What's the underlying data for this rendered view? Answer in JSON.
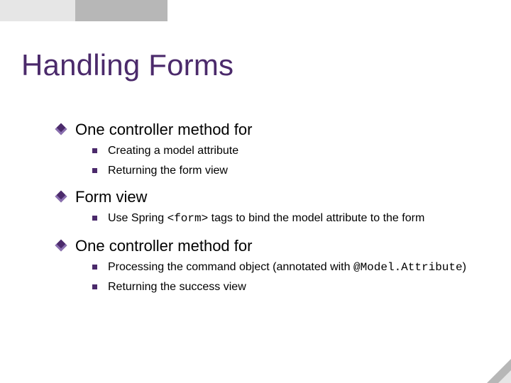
{
  "title": "Handling Forms",
  "outline": [
    {
      "text": "One controller method for",
      "children": [
        {
          "text": "Creating a model attribute"
        },
        {
          "text": "Returning the form view"
        }
      ]
    },
    {
      "text": "Form view",
      "children": [
        {
          "segments": [
            {
              "text": "Use Spring "
            },
            {
              "text": "<form>",
              "code": true
            },
            {
              "text": " tags to bind the model attribute to the form"
            }
          ]
        }
      ]
    },
    {
      "text": "One controller method for",
      "children": [
        {
          "segments": [
            {
              "text": "Processing the command object (annotated with "
            },
            {
              "text": "@Model.Attribute",
              "code": true
            },
            {
              "text": ")"
            }
          ]
        },
        {
          "text": "Returning the success view"
        }
      ]
    }
  ]
}
